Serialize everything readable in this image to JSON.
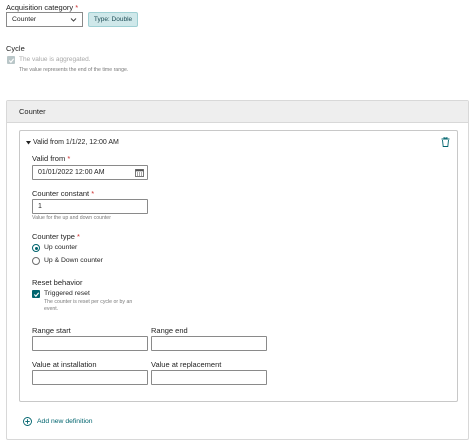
{
  "acquisition": {
    "label": "Acquisition category",
    "required_mark": "*",
    "selected": "Counter",
    "type_badge": "Type: Double"
  },
  "cycle": {
    "title": "Cycle",
    "checkbox_label": "The value is aggregated.",
    "checked": true,
    "disabled": true,
    "hint": "The value represents the end of the time range."
  },
  "counter_section": {
    "title": "Counter",
    "definition": {
      "header": "Valid from 1/1/22, 12:00 AM",
      "valid_from": {
        "label": "Valid from",
        "required_mark": "*",
        "value": "01/01/2022 12:00 AM"
      },
      "counter_constant": {
        "label": "Counter constant",
        "required_mark": "*",
        "value": "1",
        "hint": "Value for the up and down counter"
      },
      "counter_type": {
        "label": "Counter type",
        "required_mark": "*",
        "options": [
          "Up counter",
          "Up & Down counter"
        ],
        "selected": "Up counter"
      },
      "reset_behavior": {
        "label": "Reset behavior",
        "checkbox_label": "Triggered reset",
        "checked": true,
        "hint": "The counter is reset per cycle or by an event."
      },
      "range_start": {
        "label": "Range start",
        "value": ""
      },
      "range_end": {
        "label": "Range end",
        "value": ""
      },
      "value_at_installation": {
        "label": "Value at installation",
        "value": ""
      },
      "value_at_replacement": {
        "label": "Value at replacement",
        "value": ""
      }
    },
    "add_definition": "Add new definition"
  },
  "colors": {
    "accent": "#00646e",
    "badge_bg": "#cfe8ea",
    "section_header_bg": "#eeeeee",
    "required": "#cc2b2b"
  },
  "icons": [
    "chevron-down-icon",
    "check-icon",
    "caret-down-icon",
    "trash-icon",
    "calendar-icon",
    "plus-circle-icon"
  ]
}
